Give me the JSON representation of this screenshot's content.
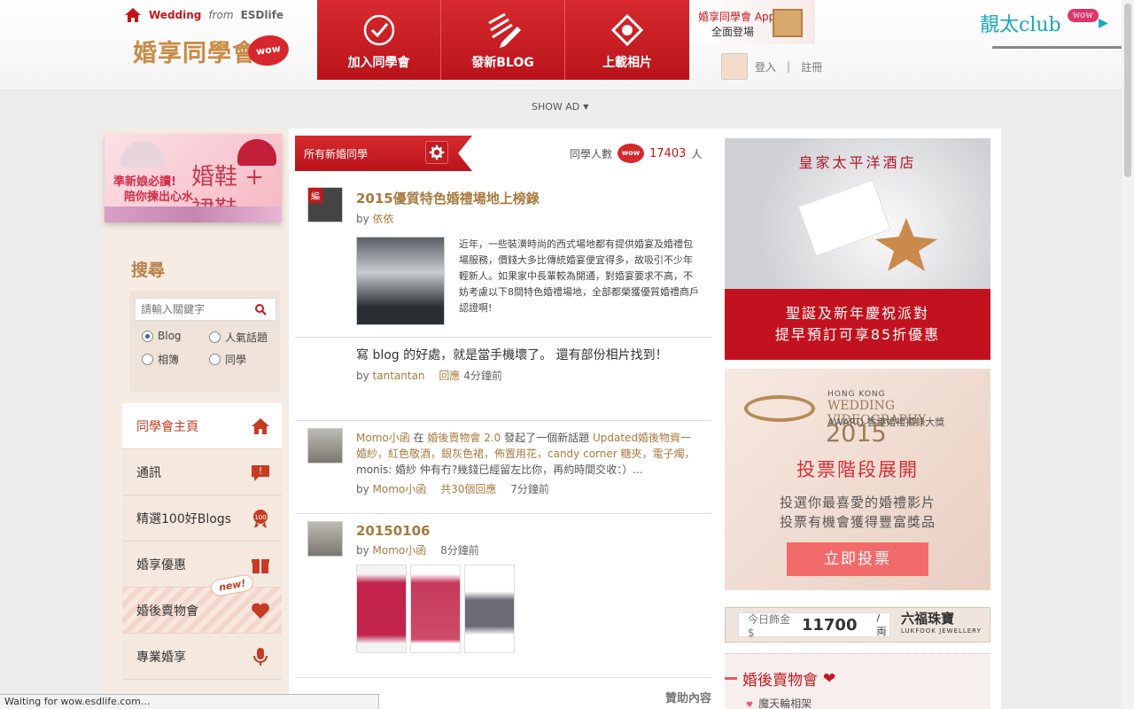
{
  "header": {
    "home_link": {
      "site": "Wedding",
      "from": "from",
      "brand": "ESDlife"
    },
    "logo": {
      "text": "婚享同學會",
      "badge": "wow"
    },
    "nav": [
      {
        "label": "加入同學會",
        "icon": "check-circle-icon"
      },
      {
        "label": "發新BLOG",
        "icon": "pencil-lines-icon"
      },
      {
        "label": "上載相片",
        "icon": "photo-upload-icon"
      }
    ],
    "app_promo": {
      "line1": "婚享同學會 App",
      "line2": "全面登場"
    },
    "auth": {
      "login": "登入",
      "separator": "|",
      "register": "註冊"
    },
    "club": {
      "text": "靚太club",
      "badge": "wow"
    },
    "show_ad": "SHOW AD"
  },
  "left": {
    "bridal_ad": {
      "line1": "準新娘必讀!",
      "line2": "陪你揀出心水",
      "title": "婚鞋 + 裙鞋"
    },
    "search": {
      "title": "搜尋",
      "placeholder": "請輸入關鍵字",
      "options": [
        "Blog",
        "人氣話題",
        "相簿",
        "同學"
      ],
      "selected": "Blog"
    },
    "nav": [
      {
        "label": "同學會主頁",
        "icon": "home-icon"
      },
      {
        "label": "通訊",
        "icon": "message-icon"
      },
      {
        "label": "精選100好Blogs",
        "icon": "award-100-icon"
      },
      {
        "label": "婚享優惠",
        "icon": "gift-icon"
      },
      {
        "label": "婚後賣物會",
        "icon": "heart-hand-icon",
        "badge": "new!"
      },
      {
        "label": "專業婚享",
        "icon": "microphone-icon"
      }
    ]
  },
  "center": {
    "ribbon_label": "所有新婚同學",
    "member_count": {
      "label": "同學人數",
      "badge": "wow",
      "value": "17403",
      "unit": "人"
    },
    "feed": [
      {
        "badge": "編",
        "title": "2015優質特色婚禮場地上榜錄",
        "by_prefix": "by",
        "author": "依依",
        "excerpt": "近年，一些裝潢時尚的西式場地都有提供婚宴及婚禮包場服務，價錢大多比傳統婚宴便宜得多，故吸引不少年輕新人。如果家中長輩較為開通，對婚宴要求不高，不妨考慮以下8間特色婚禮場地，全部都榮獲優質婚禮商戶認證啊!"
      },
      {
        "title": "寫 blog 的好處，就是當手機壞了。 還有部份相片找到！",
        "by_prefix": "by",
        "author": "tantantan",
        "reply_label": "回應",
        "time": "4分鐘前"
      },
      {
        "activity": {
          "user": "Momo小函",
          "in": "在",
          "group": "婚後賣物會 2.0",
          "action": "發起了一個新話題",
          "topic": "Updated婚後物資一婚紗，紅色敬酒，銀灰色裙，佈置用花，candy corner 糖夾，電子燭，",
          "tail": "monis: 婚紗 仲有冇?幾錢已經留左比你，再約時間交收：）..."
        },
        "by_prefix": "by",
        "author": "Momo小函",
        "replies": "共30個回應",
        "time": "7分鐘前"
      },
      {
        "title": "20150106",
        "by_prefix": "by",
        "author": "Momo小函",
        "time": "8分鐘前"
      }
    ],
    "sponsored": "贊助內容"
  },
  "right": {
    "hotel_ad": {
      "name": "皇家太平洋酒店",
      "line1": "聖誕及新年慶祝派對",
      "line2": "提早預訂可享85折優惠"
    },
    "video_ad": {
      "hk": "HONG KONG",
      "title": "WEDDING VIDEOGRAPHY",
      "award": "AWARD 香港婚禮攝錄大獎",
      "year": "2015",
      "phase": "投票階段展開",
      "line1": "投選你最喜愛的婚禮影片",
      "line2": "投票有機會獲得豐富獎品",
      "button": "立即投票"
    },
    "gold": {
      "label": "今日飾金$",
      "price": "11700",
      "unit": "/両",
      "brand": "六福珠寶",
      "brand_en": "LUKFOOK JEWELLERY"
    },
    "market": {
      "title": "婚後賣物會",
      "item": "魔天輪相架"
    }
  },
  "status_bar": "Waiting for wow.esdlife.com..."
}
